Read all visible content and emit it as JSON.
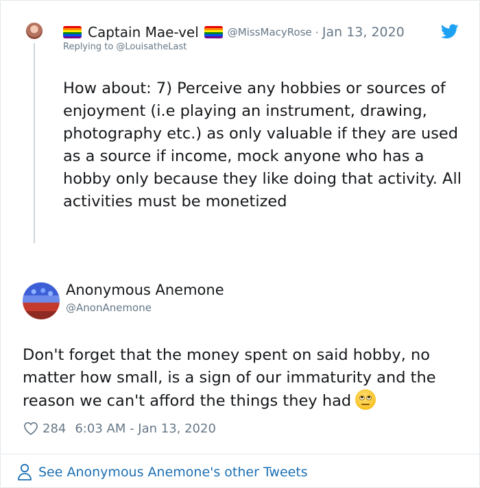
{
  "parent_tweet": {
    "name": "Captain Mae-vel",
    "handle": "@MissMacyRose",
    "separator": "·",
    "date": "Jan 13, 2020",
    "replying_to": "Replying to @LouisatheLast",
    "text": "How about: 7) Perceive any hobbies or sources of enjoyment (i.e playing an instrument, drawing, photography etc.) as only valuable if they are used as a source if income, mock anyone who has a hobby only because they like doing that activity. All activities must be monetized",
    "flag_icon": "rainbow-flag-icon"
  },
  "main_tweet": {
    "name": "Anonymous Anemone",
    "handle": "@AnonAnemone",
    "text": "Don't forget that the money spent on said hobby, no matter how small, is a sign of our immaturity and the reason we can't afford the things they had",
    "emoji": "face-with-rolling-eyes-icon",
    "likes": "284",
    "timestamp": "6:03 AM - Jan 13, 2020"
  },
  "footer": {
    "link_text": "See Anonymous Anemone's other Tweets"
  },
  "colors": {
    "text": "#14171a",
    "muted": "#657786",
    "link": "#1b6fb3",
    "twitter_blue": "#1da1f2",
    "thread_line": "#ccd6dd",
    "border": "#e1e8ed"
  }
}
